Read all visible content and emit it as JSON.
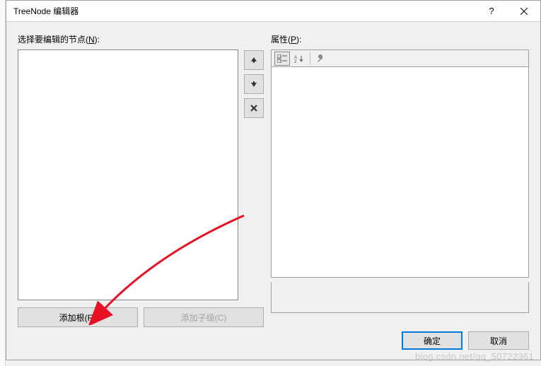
{
  "titlebar": {
    "title": "TreeNode 编辑器"
  },
  "left": {
    "label_prefix": "选择要编辑的节点(",
    "label_underline": "N",
    "label_suffix": "):",
    "add_root": "添加根(R)",
    "add_child": "添加子级(C)"
  },
  "right": {
    "label_prefix": "属性(",
    "label_underline": "P",
    "label_suffix": "):"
  },
  "buttons": {
    "ok": "确定",
    "cancel": "取消"
  },
  "watermark": "blog.csdn.net/qq_50722361"
}
